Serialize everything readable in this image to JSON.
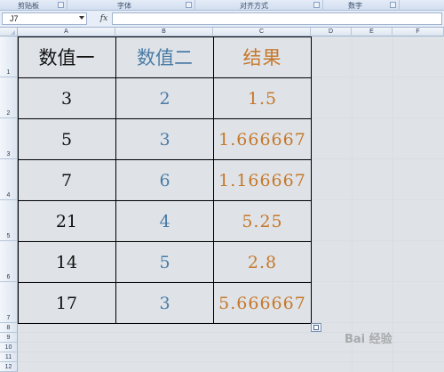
{
  "ribbon": {
    "groups": [
      {
        "label": "剪贴板"
      },
      {
        "label": "字体"
      },
      {
        "label": "对齐方式"
      },
      {
        "label": "数字"
      }
    ]
  },
  "formula_bar": {
    "name_box": "J7",
    "fx_label": "fx",
    "formula": ""
  },
  "columns": [
    "A",
    "B",
    "C",
    "D",
    "E",
    "F"
  ],
  "rows": [
    "1",
    "2",
    "3",
    "4",
    "5",
    "6",
    "7",
    "8",
    "9",
    "10",
    "11",
    "12"
  ],
  "table": {
    "headers": [
      "数值一",
      "数值二",
      "结果"
    ],
    "rows": [
      [
        "3",
        "2",
        "1.5"
      ],
      [
        "5",
        "3",
        "1.666667"
      ],
      [
        "7",
        "6",
        "1.166667"
      ],
      [
        "21",
        "4",
        "5.25"
      ],
      [
        "14",
        "5",
        "2.8"
      ],
      [
        "17",
        "3",
        "5.666667"
      ]
    ]
  },
  "watermark": "Bai 经验",
  "colors": {
    "col_a_text": "#111111",
    "col_b_text": "#4a7ba6",
    "col_c_text": "#c6782a"
  }
}
